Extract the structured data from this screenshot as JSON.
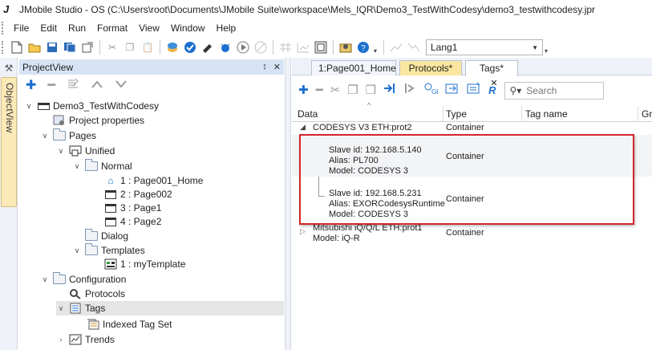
{
  "window": {
    "title": "JMobile Studio - OS (C:\\Users\\root\\Documents\\JMobile Suite\\workspace\\Mels_IQR\\Demo3_TestWithCodesy\\demo3_testwithcodesy.jpr",
    "logo_letter": "J"
  },
  "menu": [
    "File",
    "Edit",
    "Run",
    "Format",
    "View",
    "Window",
    "Help"
  ],
  "toolbar": {
    "language": "Lang1"
  },
  "side_strip": {
    "tab_label": "ObjectView"
  },
  "project_view": {
    "title": "ProjectView",
    "pin_glyph": "↕",
    "close_glyph": "✕",
    "tree": [
      {
        "label": "Demo3_TestWithCodesy"
      },
      {
        "label": "Project properties"
      },
      {
        "label": "Pages"
      },
      {
        "label": "Unified"
      },
      {
        "label": "Normal"
      },
      {
        "label": "1 : Page001_Home"
      },
      {
        "label": "2 : Page002"
      },
      {
        "label": "3 : Page1"
      },
      {
        "label": "4 : Page2"
      },
      {
        "label": "Dialog"
      },
      {
        "label": "Templates"
      },
      {
        "label": "1 : myTemplate"
      },
      {
        "label": "Configuration"
      },
      {
        "label": "Protocols"
      },
      {
        "label": "Tags"
      },
      {
        "label": "Indexed Tag Set"
      },
      {
        "label": "Trends"
      }
    ]
  },
  "editor": {
    "tabs": [
      {
        "label": "1:Page001_Home"
      },
      {
        "label": "Protocols*"
      },
      {
        "label": "Tags*",
        "close": "✕"
      }
    ],
    "search_placeholder": "Search",
    "columns": [
      "Data",
      "Type",
      "Tag name",
      "Gr"
    ],
    "rows": [
      {
        "data": "CODESYS V3 ETH:prot2",
        "type": "Container"
      },
      {
        "lines": [
          "Slave id: 192.168.5.140",
          "Alias: PL700",
          "Model: CODESYS 3"
        ],
        "type": "Container"
      },
      {
        "lines": [
          "Slave id: 192.168.5.231",
          "Alias: EXORCodesysRuntime",
          "Model: CODESYS 3"
        ],
        "type": "Container"
      },
      {
        "lines": [
          "Mitsubishi iQ/Q/L ETH:prot1",
          "Model: iQ-R"
        ],
        "type": "Container"
      }
    ]
  },
  "colors": {
    "accent_blue": "#1d6fcf",
    "protocols_tab": "#fbe7a0",
    "highlight_box": "#d3272b",
    "panel_header": "#d6e3f4"
  }
}
